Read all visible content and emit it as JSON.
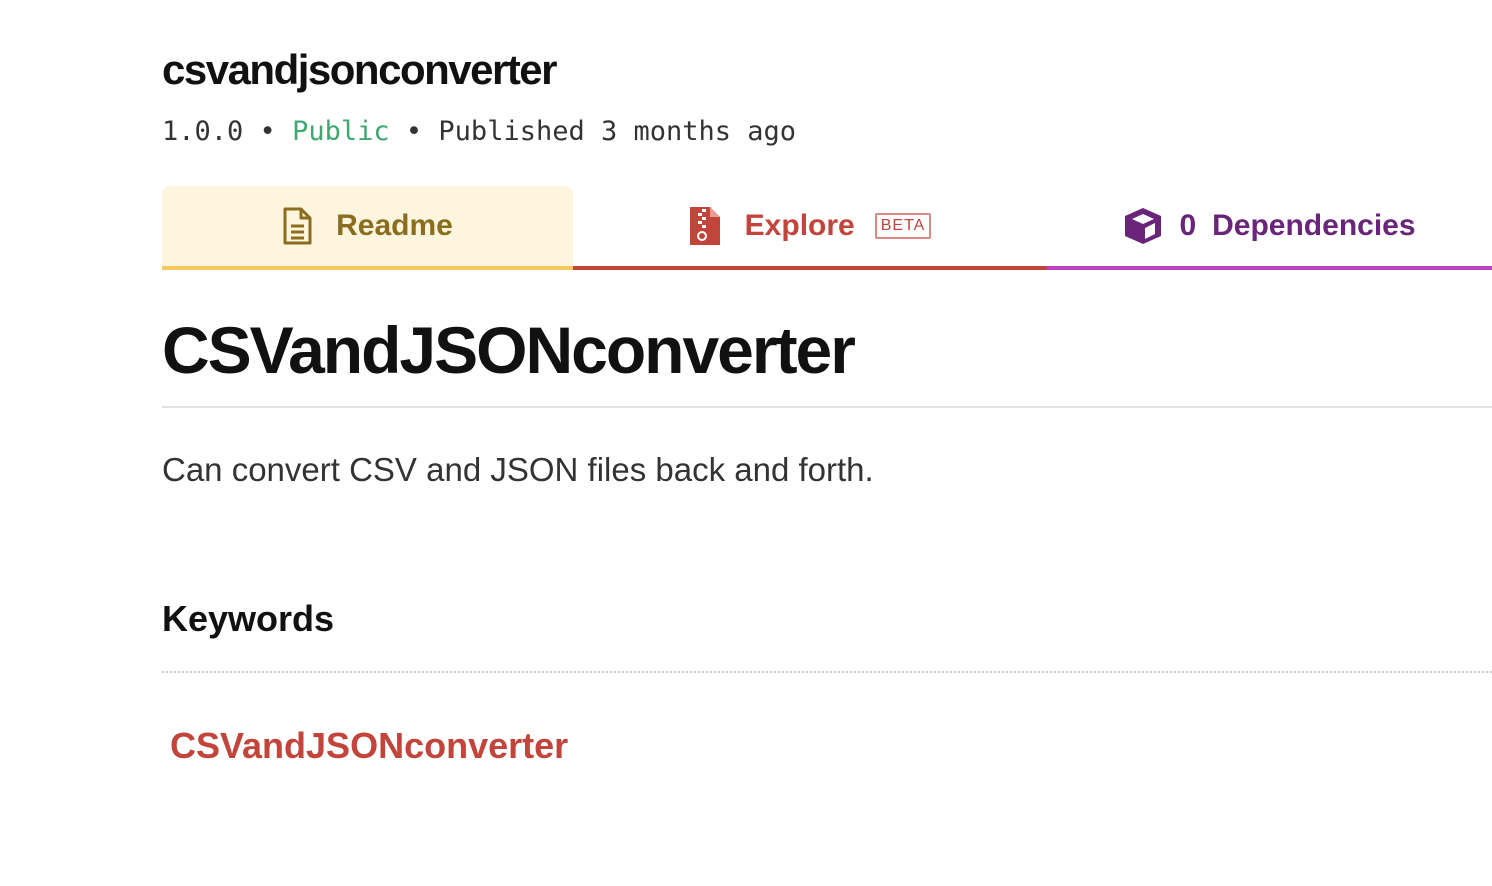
{
  "package": {
    "name": "csvandjsonconverter",
    "version": "1.0.0",
    "separator": "•",
    "visibility": "Public",
    "published": "Published 3 months ago"
  },
  "tabs": {
    "readme": {
      "label": "Readme",
      "icon": "document-icon"
    },
    "explore": {
      "label": "Explore",
      "badge": "BETA",
      "icon": "zip-file-icon"
    },
    "dependencies": {
      "count": "0",
      "label": "Dependencies",
      "icon": "box-icon"
    }
  },
  "readme": {
    "title": "CSVandJSONconverter",
    "description": "Can convert CSV and JSON files back and forth."
  },
  "keywords": {
    "heading": "Keywords",
    "items": [
      "CSVandJSONconverter"
    ]
  },
  "colors": {
    "public": "#3fa76f",
    "readme_tab_bg": "#fdf5dd",
    "readme_tab_border": "#f4c95b",
    "readme_tab_text": "#8a6d1e",
    "explore_accent": "#c2443a",
    "deps_border": "#c042c0",
    "deps_text": "#6a2479",
    "keyword_link": "#c2443a"
  }
}
